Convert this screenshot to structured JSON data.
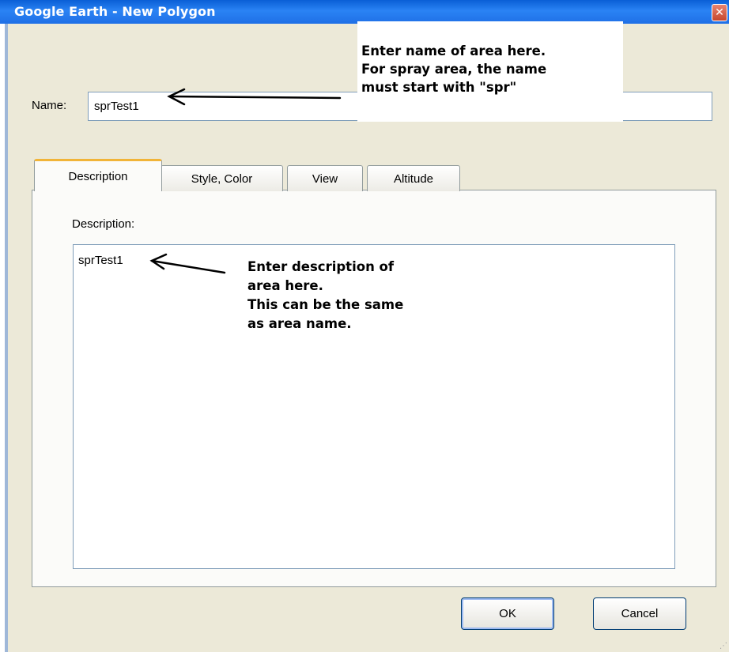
{
  "window": {
    "title": "Google Earth - New Polygon",
    "close_glyph": "✕"
  },
  "name_field": {
    "label": "Name:",
    "value": "sprTest1"
  },
  "name_callout": {
    "lines": [
      "Enter name of area here.",
      "For spray area, the name",
      "must start with \"spr\""
    ]
  },
  "tabs": [
    {
      "label": "Description",
      "active": true
    },
    {
      "label": "Style, Color",
      "active": false
    },
    {
      "label": "View",
      "active": false
    },
    {
      "label": "Altitude",
      "active": false
    }
  ],
  "description": {
    "label": "Description:",
    "value": "sprTest1",
    "callout_lines": [
      "Enter description of",
      "area here.",
      "This can be the same",
      "as area name."
    ]
  },
  "buttons": {
    "ok": "OK",
    "cancel": "Cancel"
  },
  "icons": {
    "close": "close-icon",
    "arrow": "arrow-left-icon",
    "grip": "resize-grip-icon"
  },
  "colors": {
    "titlebar": "#1f6fe6",
    "active_tab_accent": "#f1b438",
    "dialog_bg": "#ece9d8"
  }
}
